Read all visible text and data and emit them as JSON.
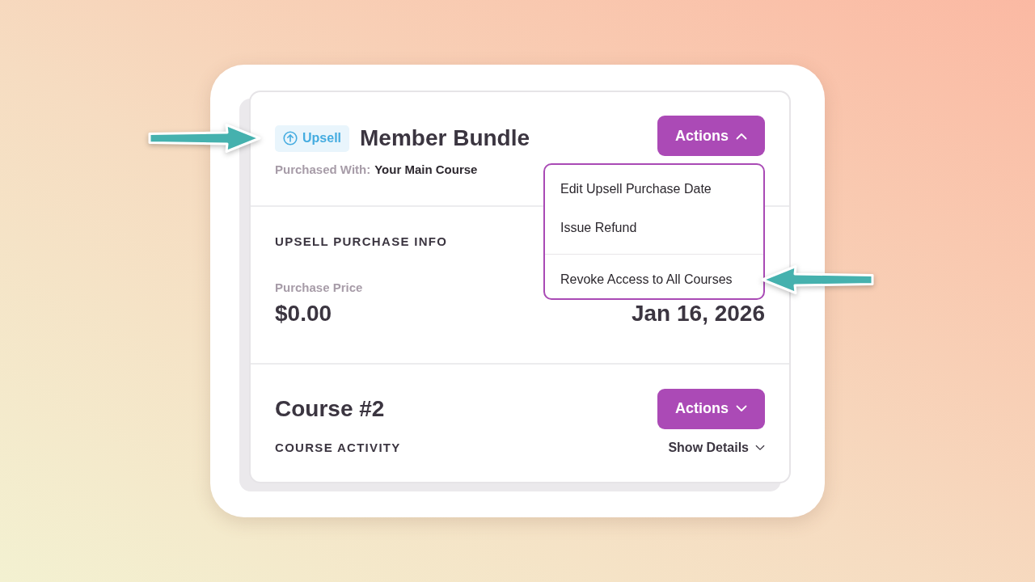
{
  "card": {
    "header": {
      "tag": {
        "label": "Upsell",
        "callout": true
      },
      "title": "Member Bundle",
      "purchased_with": {
        "label": "Purchased With:",
        "value": "Your Main Course"
      },
      "actions_button": {
        "label": "Actions",
        "expanded": true
      },
      "menu": {
        "groups": [
          {
            "items": [
              {
                "label": "Edit Upsell Purchase Date",
                "callout": false
              },
              {
                "label": "Issue Refund",
                "callout": false
              }
            ]
          },
          {
            "items": [
              {
                "label": "Revoke Access to All Courses",
                "callout": true
              }
            ]
          }
        ]
      }
    },
    "purchase_info": {
      "heading": "UPSELL PURCHASE INFO",
      "price": {
        "label": "Purchase Price",
        "value": "$0.00"
      },
      "date": {
        "value": "Jan 16, 2026"
      }
    },
    "course": {
      "title": "Course #2",
      "actions_button": {
        "label": "Actions",
        "expanded": false
      },
      "activity_heading": "COURSE ACTIVITY",
      "details_toggle": {
        "label": "Show Details",
        "expanded": false
      }
    }
  }
}
